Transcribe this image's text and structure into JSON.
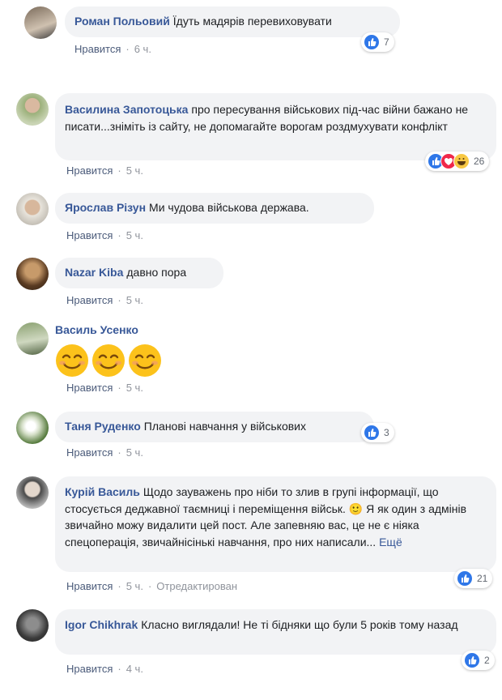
{
  "comments": [
    {
      "name": "Роман Польовий",
      "text": "Їдуть мадярів перевиховувати",
      "like": "Нравится",
      "time": "6 ч.",
      "reactions": "7"
    },
    {
      "name": "Василина Запотоцька",
      "text": "про пересування військових під-час війни бажано не писати...зніміть із сайту, не допомагайте ворогам роздмухувати конфлікт",
      "like": "Нравится",
      "time": "5 ч.",
      "reactions": "26"
    },
    {
      "name": "Ярослав Різун",
      "text": "Ми чудова військова держава.",
      "like": "Нравится",
      "time": "5 ч."
    },
    {
      "name": "Nazar Kiba",
      "text": "давно пора",
      "like": "Нравится",
      "time": "5 ч."
    },
    {
      "name": "Василь Усенко",
      "text": "",
      "emoji": [
        "smiling-face",
        "smiling-face",
        "smiling-face"
      ],
      "like": "Нравится",
      "time": "5 ч."
    },
    {
      "name": "Таня Руденко",
      "text": "Планові навчання у військових",
      "like": "Нравится",
      "time": "5 ч.",
      "reactions": "3"
    },
    {
      "name": "Курій Василь",
      "text": "Щодо зауважень про ніби то злив в групі інформації, що стосується деджавної таємниці і переміщення військ. 🙂 Я як один з адмінів звичайно можу видалити цей пост. Але запевняю вас, це не є ніяка спецоперація, звичайнісінькі навчання, про них написали...",
      "more": "Ещё",
      "like": "Нравится",
      "time": "5 ч.",
      "edited": "Отредактирован",
      "reactions": "21"
    },
    {
      "name": "Igor Chikhrak",
      "text": "Класно виглядали! Не ті бідняки що були 5 років тому назад",
      "like": "Нравится",
      "time": "4 ч.",
      "reactions": "2"
    }
  ],
  "colors": {
    "name": "#385898",
    "bubble": "#f2f3f5",
    "like": "#2f77e8",
    "love": "#f0284a",
    "haha": "#f7c844"
  }
}
